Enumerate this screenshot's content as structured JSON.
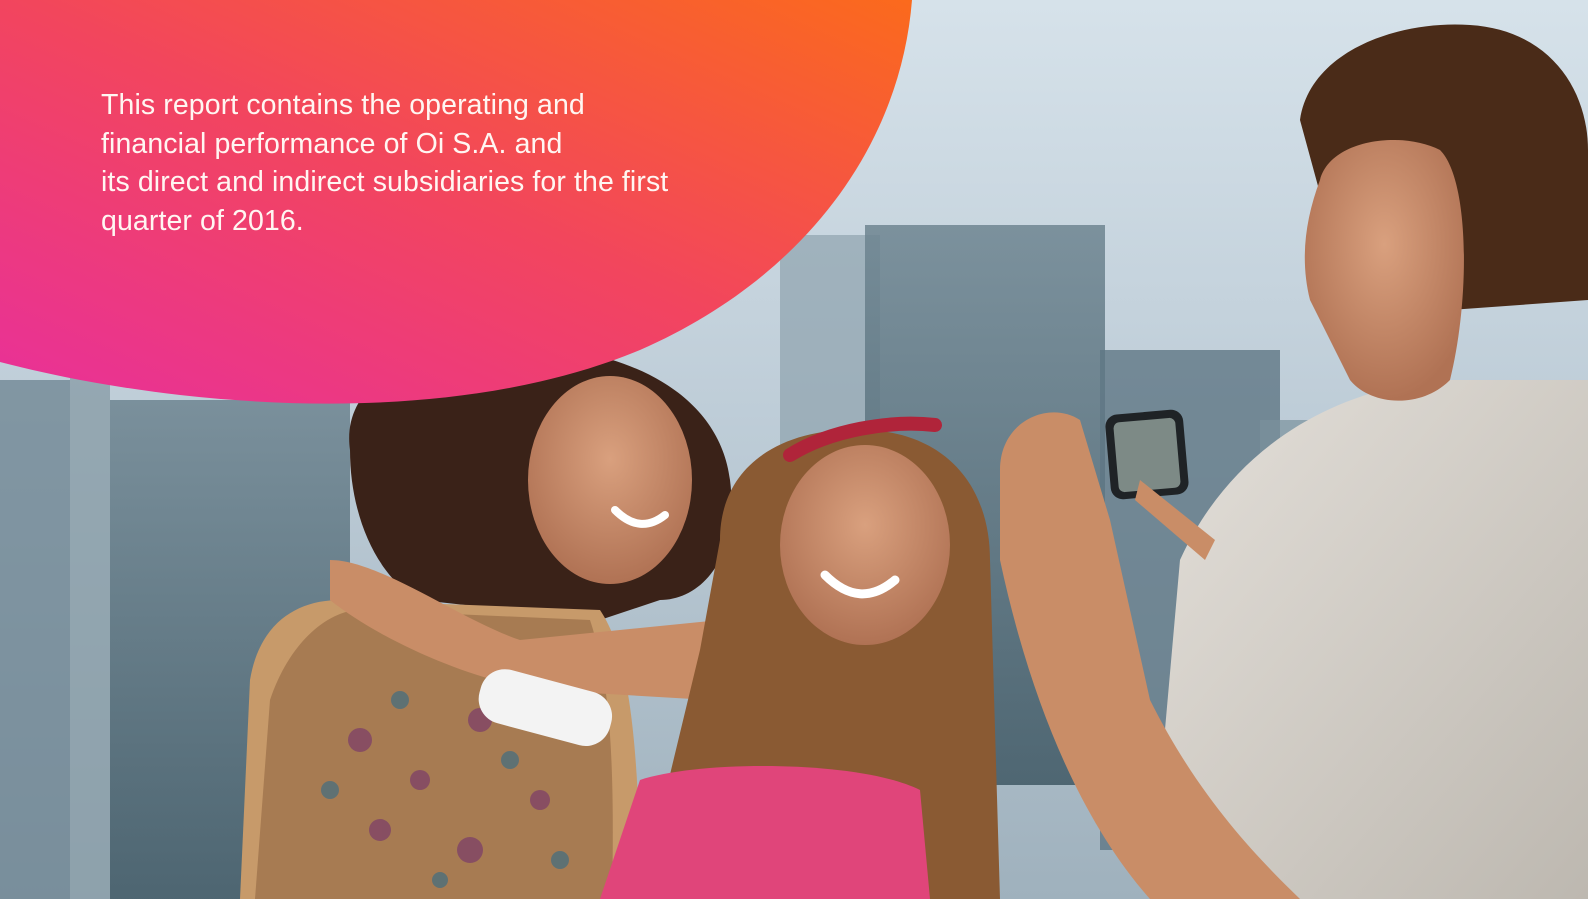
{
  "report": {
    "intro_lines": [
      "This report contains the operating and",
      "financial performance of Oi S.A. and",
      "its direct and indirect subsidiaries for the first",
      "quarter of 2016."
    ]
  },
  "colors": {
    "blob_gradient_start": "#e8309a",
    "blob_gradient_mid": "#f2455e",
    "blob_gradient_end": "#fb6a1c",
    "sky": "#c9d8e2",
    "text": "#fff6f2"
  }
}
